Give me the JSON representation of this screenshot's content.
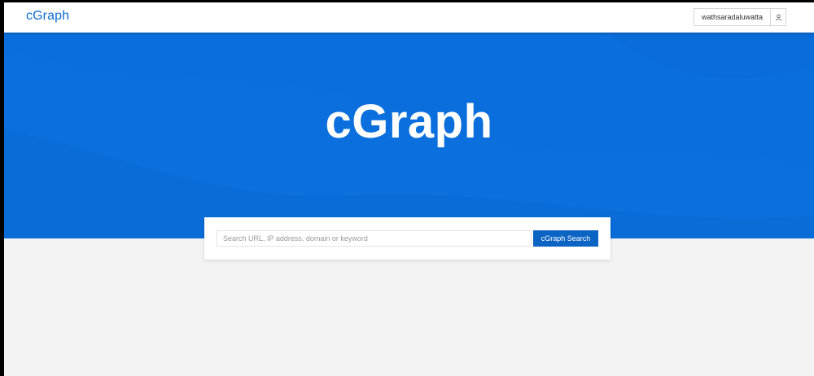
{
  "header": {
    "brand": "cGraph",
    "username": "wathsaradaluwatta",
    "user_icon": "user-icon"
  },
  "hero": {
    "title": "cGraph"
  },
  "search": {
    "placeholder": "Search URL, IP address, domain or keyword",
    "value": "",
    "button_label": "cGraph Search",
    "search_icon": "none"
  },
  "colors": {
    "accent": "#0a6fdc",
    "button": "#0b63c4",
    "brand_text": "#0f6cce",
    "page_background": "#f3f3f3"
  }
}
